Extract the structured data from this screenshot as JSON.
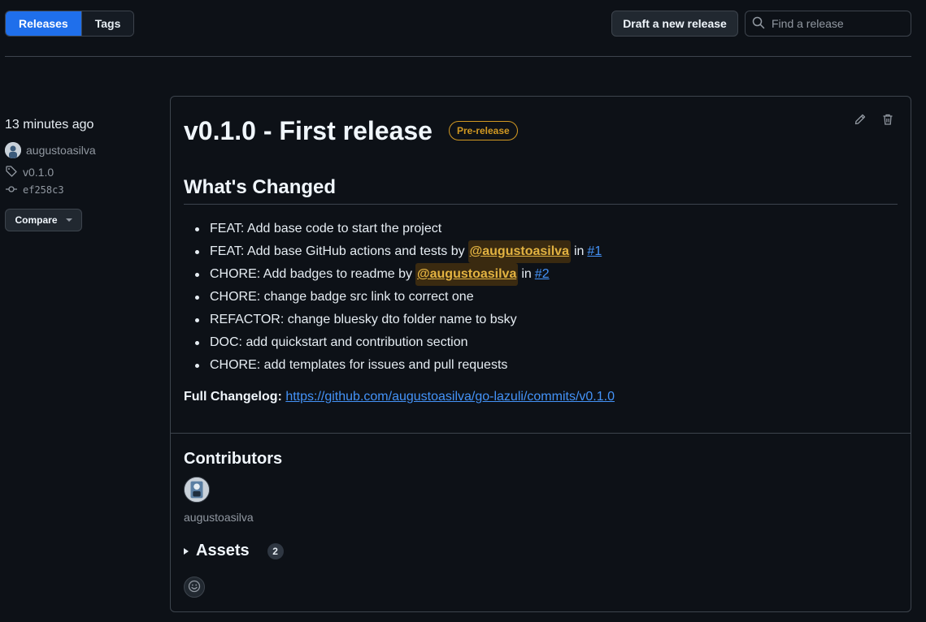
{
  "tabs": [
    {
      "label": "Releases",
      "active": true
    },
    {
      "label": "Tags",
      "active": false
    }
  ],
  "toolbar": {
    "draft_label": "Draft a new release",
    "search_placeholder": "Find a release"
  },
  "meta": {
    "time": "13 minutes ago",
    "author": "augustoasilva",
    "tag": "v0.1.0",
    "commit": "ef258c3",
    "compare_label": "Compare"
  },
  "release": {
    "title": "v0.1.0 - First release",
    "badge": "Pre-release",
    "whats_changed": "What's Changed",
    "changes": [
      {
        "text": "FEAT: Add base code to start the project"
      },
      {
        "text": "FEAT: Add base GitHub actions and tests by",
        "mention": "@augustoasilva",
        "in": "in",
        "pr": "#1"
      },
      {
        "text": "CHORE: Add badges to readme by",
        "mention": "@augustoasilva",
        "in": "in",
        "pr": "#2"
      },
      {
        "text": "CHORE: change badge src link to correct one"
      },
      {
        "text": "REFACTOR: change bluesky dto folder name to bsky"
      },
      {
        "text": "DOC: add quickstart and contribution section"
      },
      {
        "text": "CHORE: add templates for issues and pull requests"
      }
    ],
    "changelog_label": "Full Changelog:",
    "changelog_url": "https://github.com/augustoasilva/go-lazuli/commits/v0.1.0"
  },
  "contributors": {
    "heading": "Contributors",
    "names": [
      "augustoasilva"
    ]
  },
  "assets": {
    "label": "Assets",
    "count": "2"
  },
  "colors": {
    "accent": "#1f6feb",
    "prerelease": "#d29922",
    "link": "#4493f8",
    "background": "#0d1117"
  }
}
